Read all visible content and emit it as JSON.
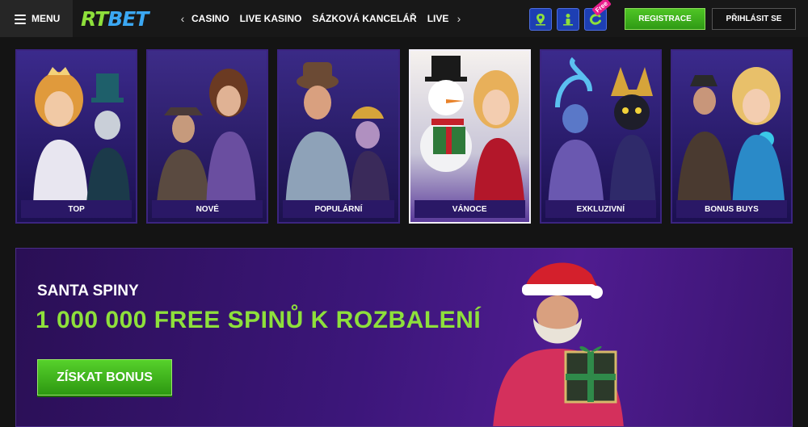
{
  "header": {
    "menu_label": "MENU",
    "logo_rt": "RT",
    "logo_bet": "BET",
    "nav_items": [
      "CASINO",
      "LIVE KASINO",
      "SÁZKOVÁ KANCELÁŘ",
      "LIVE S"
    ],
    "free_tag": "Free",
    "register_label": "REGISTRACE",
    "login_label": "PŘIHLÁSIT SE",
    "icons": [
      "location-icon",
      "person-icon",
      "free-coin-icon"
    ]
  },
  "categories": [
    {
      "label": "TOP"
    },
    {
      "label": "NOVÉ"
    },
    {
      "label": "POPULÁRNÍ"
    },
    {
      "label": "VÁNOCE"
    },
    {
      "label": "EXKLUZIVNÍ"
    },
    {
      "label": "BONUS BUYS"
    }
  ],
  "promo": {
    "subtitle": "SANTA SPINY",
    "title": "1 000 000 FREE SPINŮ K ROZBALENÍ",
    "button_label": "ZÍSKAT BONUS"
  },
  "colors": {
    "accent_green": "#8ee03b",
    "logo_blue": "#3ba7f2",
    "brand_purple": "#3c167a"
  }
}
